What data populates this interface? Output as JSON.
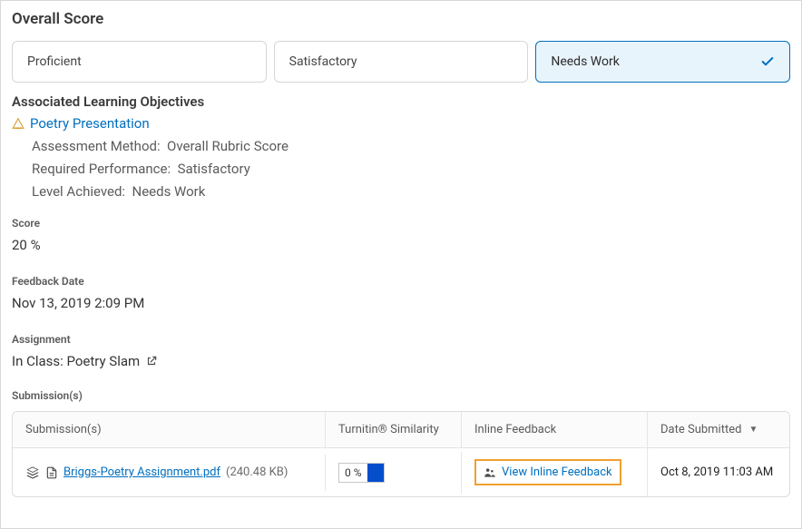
{
  "title": "Overall Score",
  "tiles": {
    "proficient": "Proficient",
    "satisfactory": "Satisfactory",
    "needs_work": "Needs Work"
  },
  "alo": {
    "heading": "Associated Learning Objectives",
    "link_text": "Poetry Presentation",
    "assessment_method_label": "Assessment Method:",
    "assessment_method_value": "Overall Rubric Score",
    "required_perf_label": "Required Performance:",
    "required_perf_value": "Satisfactory",
    "level_achieved_label": "Level Achieved:",
    "level_achieved_value": "Needs Work"
  },
  "score": {
    "label": "Score",
    "value": "20 %"
  },
  "feedback_date": {
    "label": "Feedback Date",
    "value": "Nov 13, 2019 2:09 PM"
  },
  "assignment": {
    "label": "Assignment",
    "value": "In Class: Poetry Slam"
  },
  "submissions": {
    "label": "Submission(s)",
    "headers": {
      "sub": "Submission(s)",
      "sim": "Turnitin® Similarity",
      "fb": "Inline Feedback",
      "date": "Date Submitted"
    },
    "row": {
      "file_name": "Briggs-Poetry Assignment.pdf",
      "file_size": "(240.48 KB)",
      "similarity": "0 %",
      "inline_feedback": "View Inline Feedback",
      "date": "Oct 8, 2019 11:03 AM"
    }
  }
}
